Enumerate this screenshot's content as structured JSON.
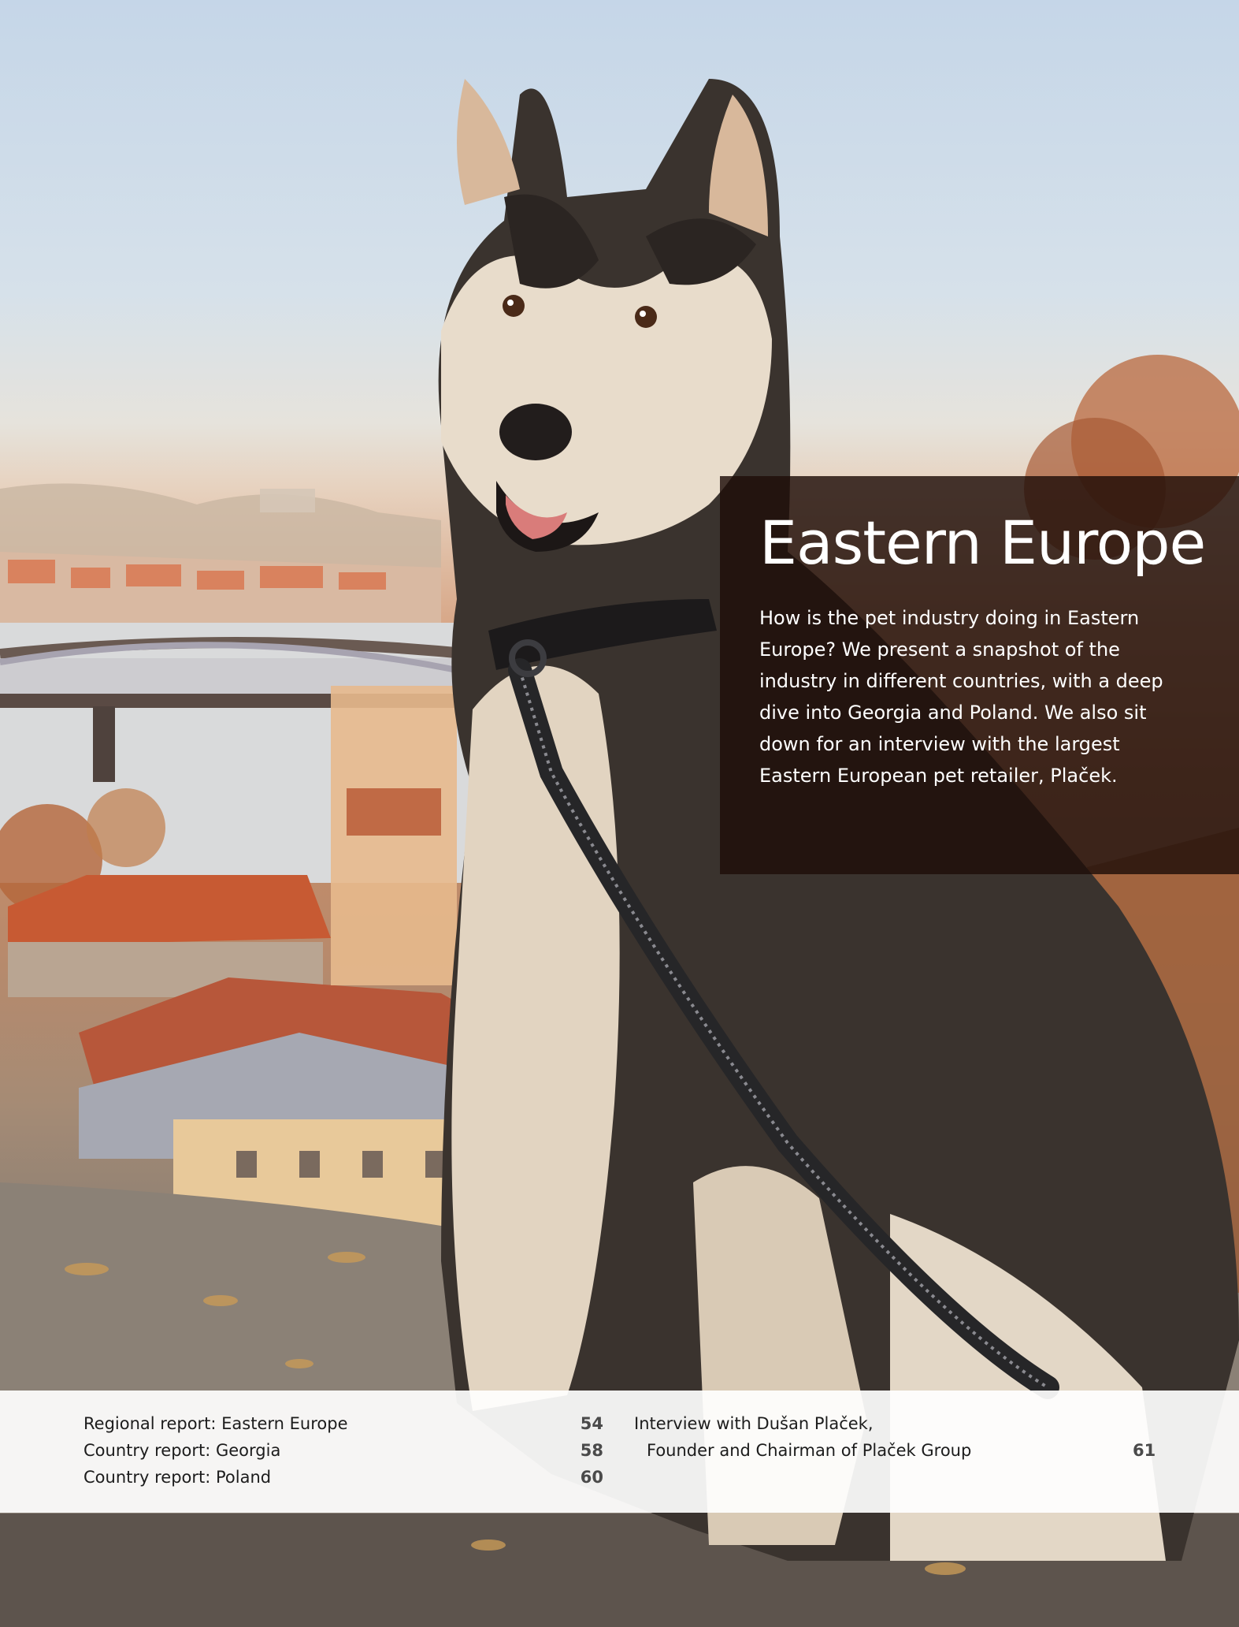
{
  "section": {
    "title": "Eastern Europe",
    "intro": "How is the pet industry doing in Eastern Europe? We present a snapshot of the industry in different countries, with a deep dive into Georgia and Poland. We also sit down for an interview with the largest Eastern European pet retailer, Plaček."
  },
  "toc": {
    "left": [
      {
        "label": "Regional report: Eastern Europe",
        "page": "54"
      },
      {
        "label": "Country report: Georgia",
        "page": "58"
      },
      {
        "label": "Country report: Poland",
        "page": "60"
      }
    ],
    "right": {
      "line1": "Interview with Dušan Plaček,",
      "line2": "Founder and Chairman of Plaček Group",
      "page": "61"
    }
  },
  "colors": {
    "panel": "#1e0e08",
    "sky": "#c5d6e8",
    "roof": "#c8623c",
    "fur_dark": "#2a2623",
    "fur_light": "#e6d9c8"
  }
}
